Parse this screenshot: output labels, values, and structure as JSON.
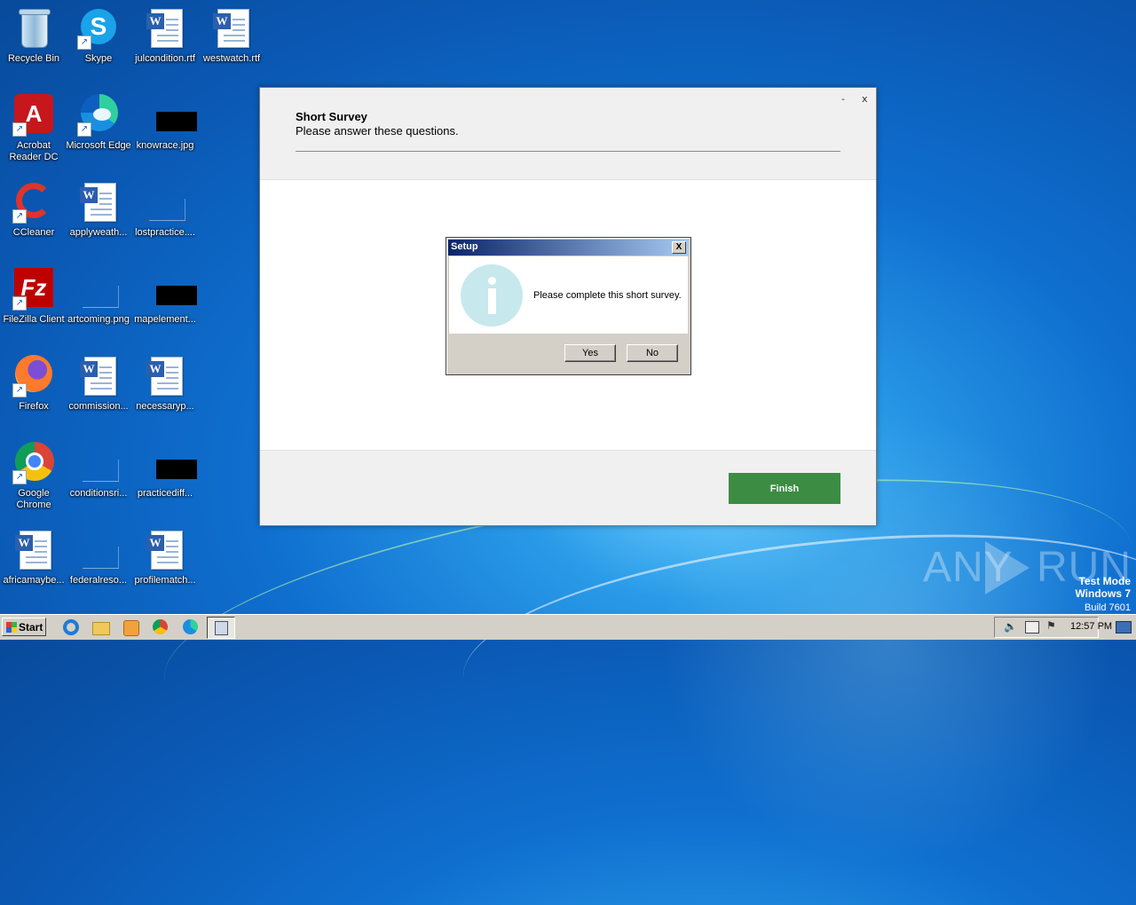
{
  "desktop": {
    "icons": [
      {
        "label": "Recycle Bin"
      },
      {
        "label": "Skype"
      },
      {
        "label": "julcondition.rtf"
      },
      {
        "label": "westwatch.rtf"
      },
      {
        "label": "Acrobat Reader DC"
      },
      {
        "label": "Microsoft Edge"
      },
      {
        "label": "knowrace.jpg"
      },
      {
        "label": "CCleaner"
      },
      {
        "label": "applyweath..."
      },
      {
        "label": "lostpractice...."
      },
      {
        "label": "FileZilla Client"
      },
      {
        "label": "artcoming.png"
      },
      {
        "label": "mapelement..."
      },
      {
        "label": "Firefox"
      },
      {
        "label": "commission..."
      },
      {
        "label": "necessaryp..."
      },
      {
        "label": "Google Chrome"
      },
      {
        "label": "conditionsri..."
      },
      {
        "label": "practicediff..."
      },
      {
        "label": "africamaybe..."
      },
      {
        "label": "federalreso..."
      },
      {
        "label": "profilematch..."
      }
    ]
  },
  "installer": {
    "minimize_glyph": "-",
    "close_glyph": "x",
    "title": "Short Survey",
    "subtitle": "Please answer these questions.",
    "finish_label": "Finish",
    "finish_color": "#3c8c43"
  },
  "dialog": {
    "title": "Setup",
    "close_glyph": "X",
    "icon": "info-icon",
    "message": "Please complete this short survey.",
    "yes_label": "Yes",
    "no_label": "No"
  },
  "watermark": {
    "brand_left": "ANY",
    "brand_right": "RUN",
    "mode": "Test Mode",
    "os": "Windows 7",
    "build": "Build 7601"
  },
  "taskbar": {
    "start_label": "Start",
    "pinned": [
      "internet-explorer-icon",
      "file-explorer-icon",
      "media-player-icon",
      "chrome-icon",
      "edge-icon",
      "setup-app-icon"
    ],
    "clock": "12:57 PM"
  }
}
